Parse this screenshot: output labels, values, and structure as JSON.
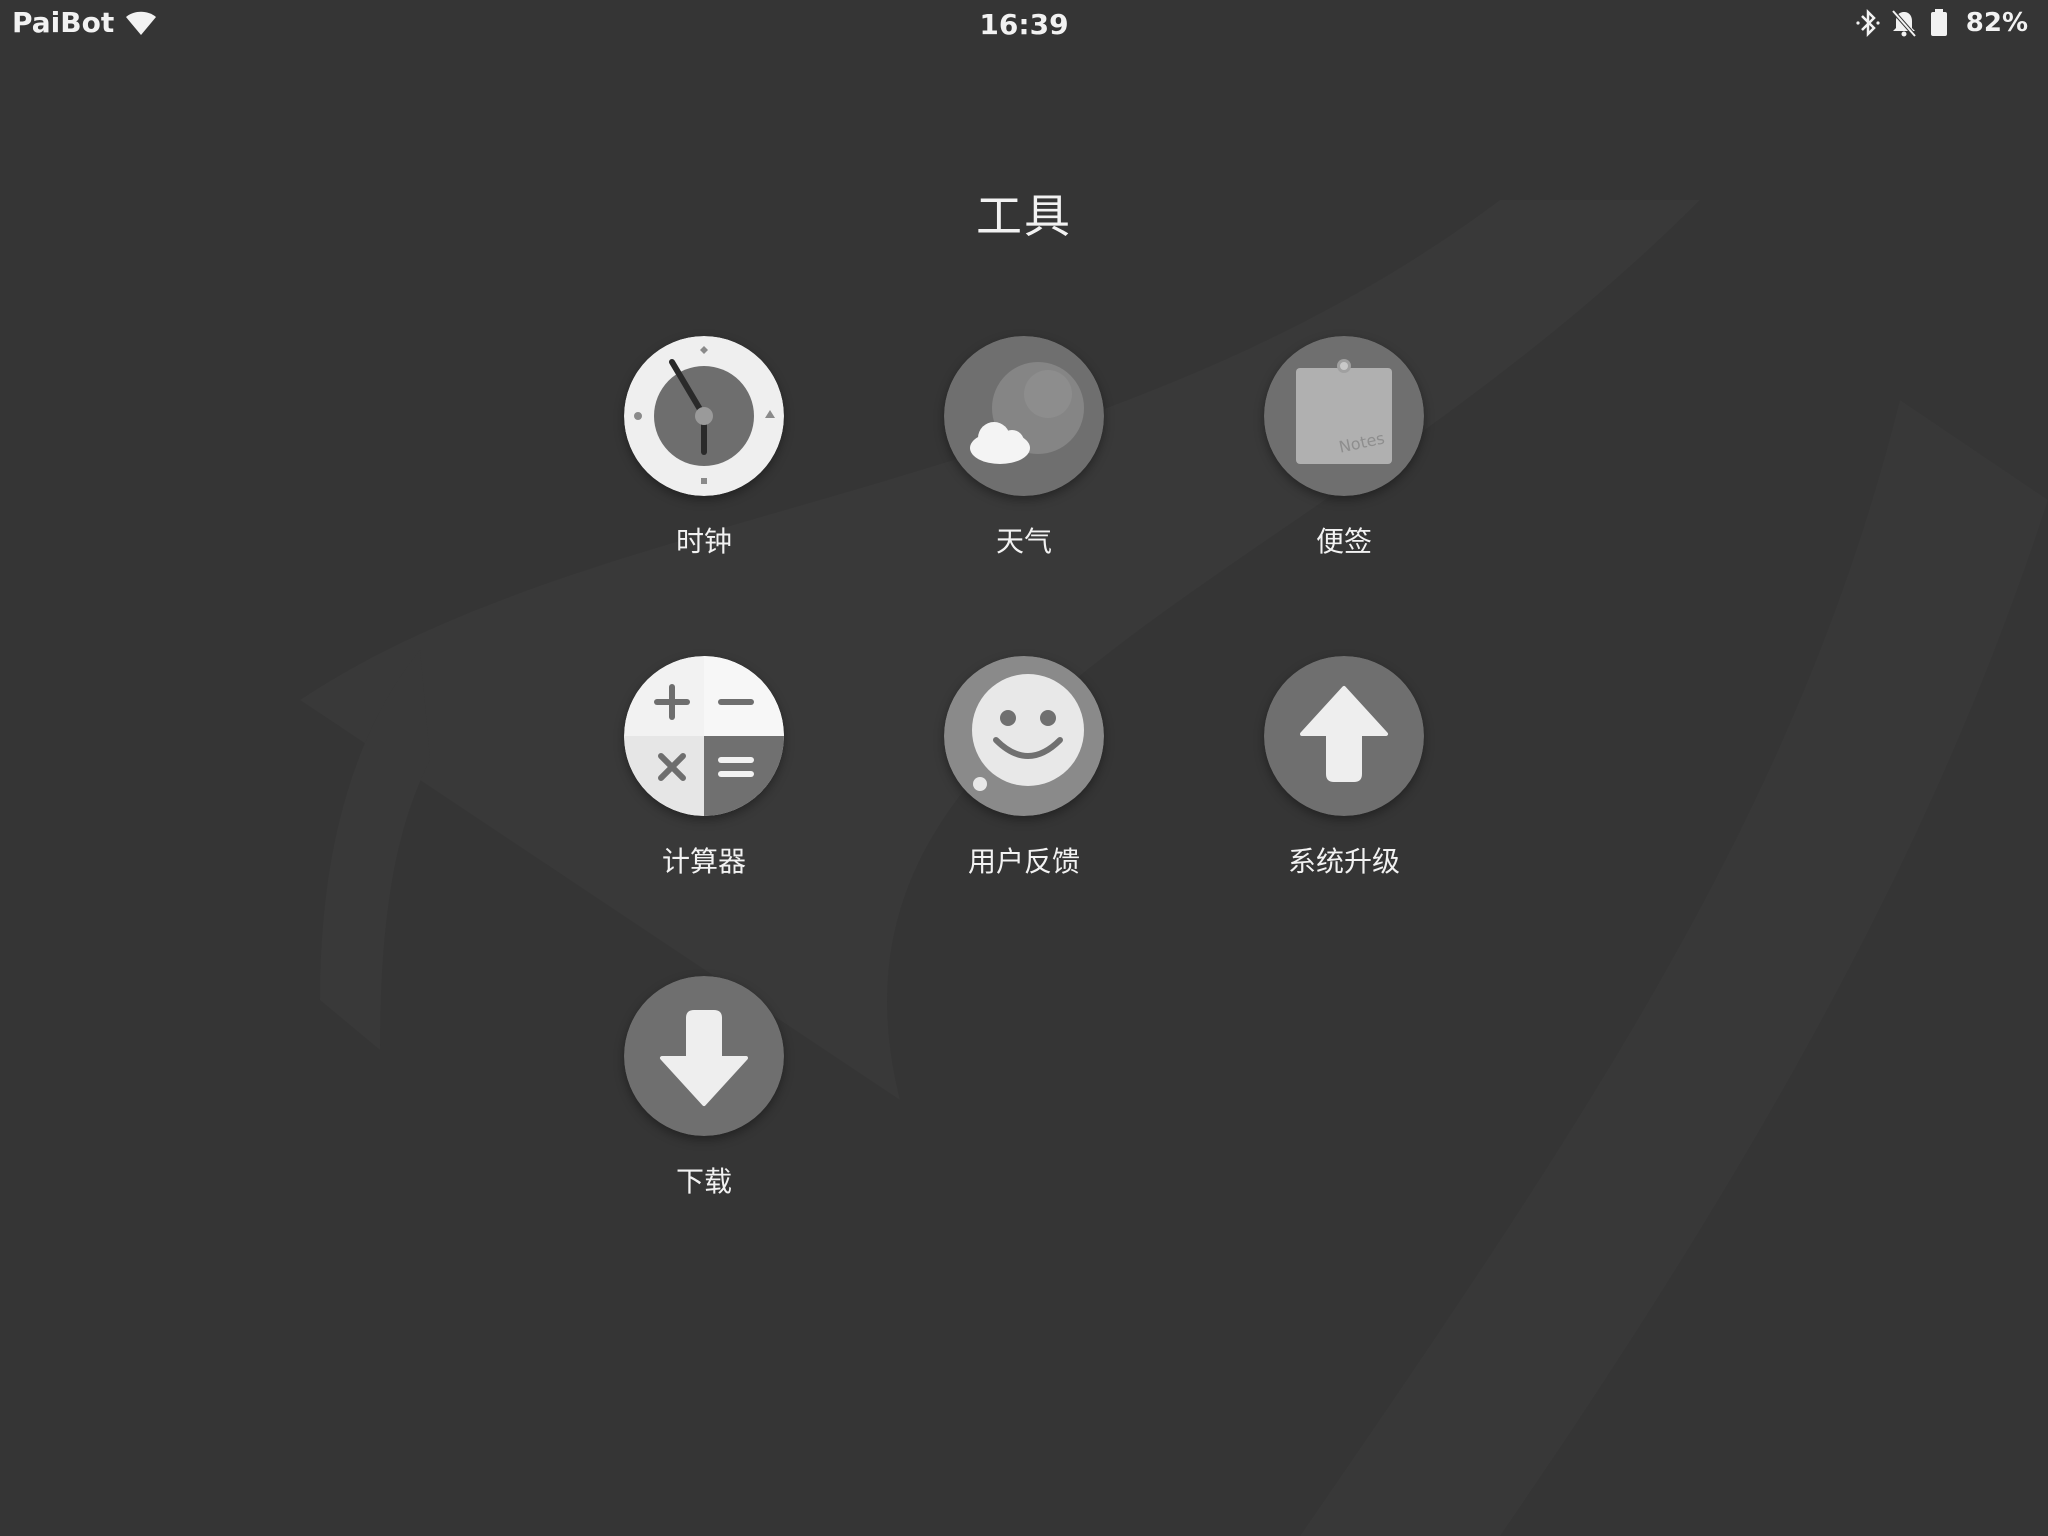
{
  "status_bar": {
    "carrier": "PaiBot",
    "time": "16:39",
    "battery": "82%",
    "icons": [
      "wifi-icon",
      "bluetooth-icon",
      "notifications-off-icon",
      "battery-icon"
    ]
  },
  "page": {
    "title": "工具"
  },
  "apps": [
    {
      "label": "时钟",
      "icon": "clock-icon"
    },
    {
      "label": "天气",
      "icon": "weather-icon"
    },
    {
      "label": "便签",
      "icon": "notes-icon"
    },
    {
      "label": "计算器",
      "icon": "calculator-icon"
    },
    {
      "label": "用户反馈",
      "icon": "feedback-icon"
    },
    {
      "label": "系统升级",
      "icon": "upgrade-icon"
    },
    {
      "label": "下载",
      "icon": "download-icon"
    }
  ],
  "notes_icon_text": "Notes"
}
